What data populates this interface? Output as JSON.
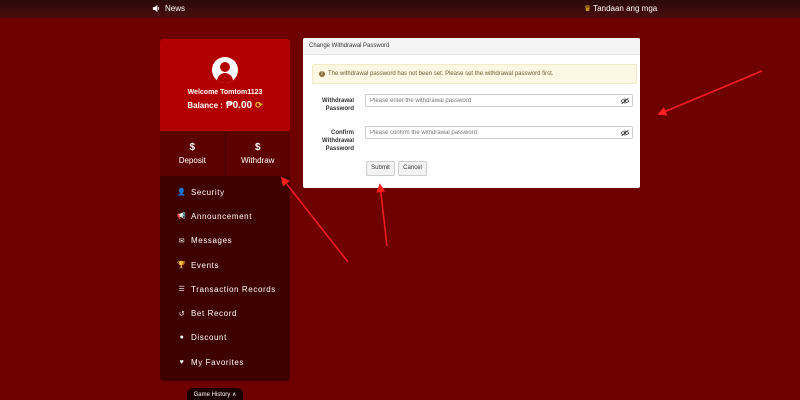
{
  "topbar": {
    "news_label": "News",
    "ticker_text": "Tandaan ang mga"
  },
  "profile": {
    "welcome": "Welcome Tomtom1123",
    "balance_label": "Balance :",
    "balance_value": "₱0.00"
  },
  "actions": {
    "deposit": "Deposit",
    "withdraw": "Withdraw"
  },
  "menu": [
    {
      "label": "Security",
      "icon": "user-shield-icon"
    },
    {
      "label": "Announcement",
      "icon": "megaphone-icon"
    },
    {
      "label": "Messages",
      "icon": "envelope-icon"
    },
    {
      "label": "Events",
      "icon": "trophy-icon"
    },
    {
      "label": "Transaction Records",
      "icon": "list-icon"
    },
    {
      "label": "Bet Record",
      "icon": "history-icon"
    },
    {
      "label": "Discount",
      "icon": "discount-icon"
    },
    {
      "label": "My Favorites",
      "icon": "heart-icon"
    }
  ],
  "game_history": "Game History ∧",
  "panel": {
    "title": "Change Withdrawal Password",
    "alert": "The withdrawal password has not been set. Please set the withdrawal password first.",
    "field1_label_line1": "Withdrawal",
    "field1_label_line2": "Password",
    "field1_placeholder": "Please enter the withdrawal password",
    "field2_label_line1": "Confirm",
    "field2_label_line2": "Withdrawal",
    "field2_label_line3": "Password",
    "field2_placeholder": "Please confirm the withdrawal password",
    "submit": "Submit",
    "cancel": "Cancel"
  },
  "colors": {
    "background": "#6e0000",
    "profile_red": "#b20000",
    "sidebar_dark": "#3f0000",
    "annotation_arrow": "#ff1f1f"
  }
}
